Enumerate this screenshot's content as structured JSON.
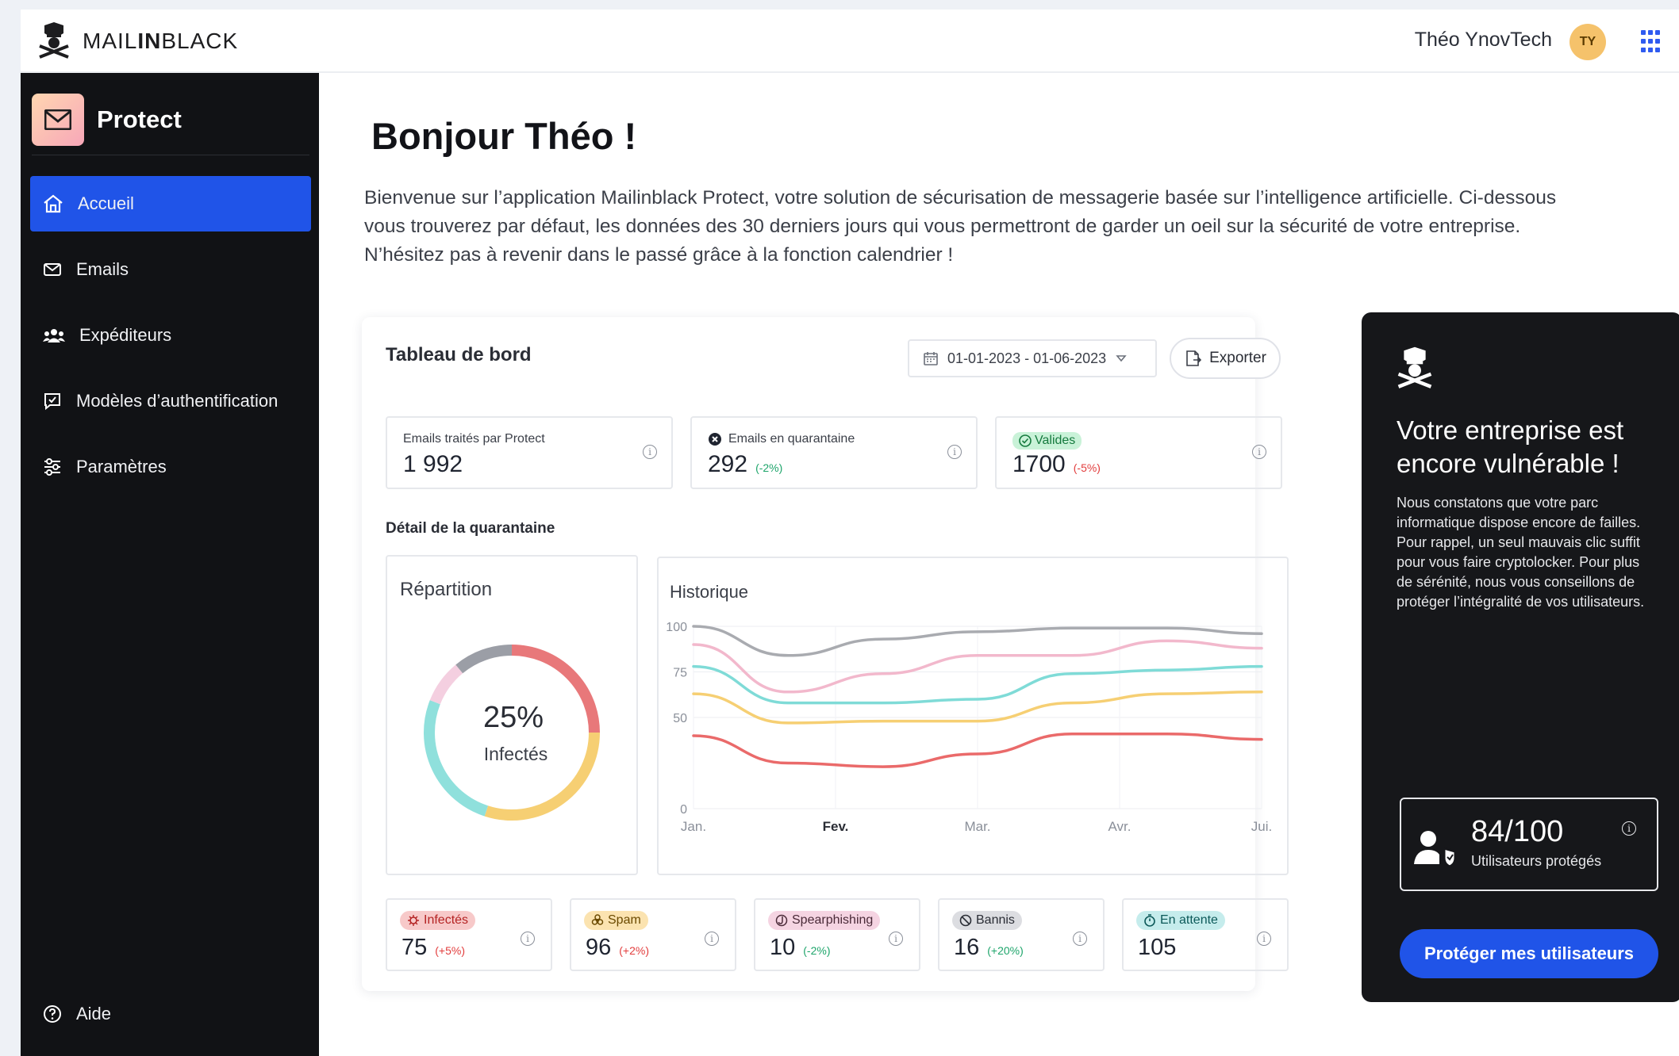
{
  "brand": {
    "name_part1": "MAIL",
    "name_part2": "IN",
    "name_part3": "BLACK"
  },
  "user": {
    "name": "Théo YnovTech",
    "initials": "TY"
  },
  "product": {
    "name": "Protect"
  },
  "sidebar": {
    "items": [
      {
        "label": "Accueil",
        "icon": "home-icon",
        "active": true
      },
      {
        "label": "Emails",
        "icon": "mail-icon",
        "active": false
      },
      {
        "label": "Expéditeurs",
        "icon": "users-icon",
        "active": false
      },
      {
        "label": "Modèles d’authentification",
        "icon": "chat-check-icon",
        "active": false
      },
      {
        "label": "Paramètres",
        "icon": "sliders-icon",
        "active": false
      }
    ],
    "help": "Aide"
  },
  "greeting": "Bonjour Théo !",
  "intro": "Bienvenue sur l’application Mailinblack Protect, votre solution de sécurisation de messagerie basée sur l’intelligence artificielle. Ci-dessous vous trouverez par défaut, les données des 30 derniers jours qui vous permettront de garder un oeil sur la sécurité de votre entreprise. N’hésitez pas à revenir dans le passé grâce à la fonction calendrier !",
  "dashboard": {
    "title": "Tableau de bord",
    "date_range": "01-01-2023  - 01-06-2023",
    "export": "Exporter",
    "kpis": [
      {
        "label": "Emails traités par Protect",
        "value": "1 992",
        "delta": ""
      },
      {
        "label": "Emails en quarantaine",
        "value": "292",
        "delta": "(-2%)"
      },
      {
        "label": "Valides",
        "value": "1700",
        "delta": "(-5%)"
      }
    ],
    "quarantine_title": "Détail de la quarantaine",
    "repartition": {
      "title": "Répartition",
      "percent": "25%",
      "label": "Infectés"
    },
    "history": {
      "title": "Historique"
    },
    "stats": [
      {
        "label": "Infectés",
        "value": "75",
        "delta": "(+5%)",
        "bg": "#f7c9c9",
        "fg": "#b42323"
      },
      {
        "label": "Spam",
        "value": "96",
        "delta": "(+2%)",
        "bg": "#fbe3b0",
        "fg": "#6b4a00"
      },
      {
        "label": "Spearphishing",
        "value": "10",
        "delta": "(-2%)",
        "bg": "#f5d4e2",
        "fg": "#4a2a38"
      },
      {
        "label": "Bannis",
        "value": "16",
        "delta": "(+20%)",
        "bg": "#dcdde1",
        "fg": "#2a2d35"
      },
      {
        "label": "En attente",
        "value": "105",
        "delta": "",
        "bg": "#c5ecec",
        "fg": "#0d5a5a"
      }
    ]
  },
  "promo": {
    "title": "Votre entreprise est encore vulnérable !",
    "text": "Nous constatons que votre parc informatique dispose encore de failles. Pour rappel, un seul mauvais clic suffit pour vous faire cryptolocker. Pour plus de sérénité, nous vous conseillons de protéger l’intégralité de vos utilisateurs.",
    "score": "84/100",
    "score_label": "Utilisateurs protégés",
    "button": "Protéger mes utilisateurs"
  },
  "chart_data": [
    {
      "type": "pie",
      "title": "Répartition",
      "center_label": "25% Infectés",
      "slices": [
        {
          "name": "Infectés",
          "value": 25,
          "color": "#e8787a"
        },
        {
          "name": "Spam",
          "value": 30,
          "color": "#f6cf73"
        },
        {
          "name": "En attente",
          "value": 26,
          "color": "#8fe0dc"
        },
        {
          "name": "Spearphishing",
          "value": 8,
          "color": "#f4cfe0"
        },
        {
          "name": "Bannis",
          "value": 11,
          "color": "#9b9ea6"
        }
      ]
    },
    {
      "type": "line",
      "title": "Historique",
      "x": [
        "Jan.",
        "Fev.",
        "Mar.",
        "Avr.",
        "Jui."
      ],
      "y_ticks": [
        0,
        50,
        75,
        100
      ],
      "ylim": [
        0,
        100
      ],
      "series": [
        {
          "color": "#a9abb0",
          "values": [
            100,
            84,
            93,
            97,
            99,
            99,
            96
          ]
        },
        {
          "color": "#f2b8cc",
          "values": [
            90,
            64,
            74,
            84,
            84,
            92,
            88
          ]
        },
        {
          "color": "#7fdbd7",
          "values": [
            78,
            58,
            58,
            60,
            74,
            76,
            78
          ]
        },
        {
          "color": "#f6cf73",
          "values": [
            63,
            47,
            48,
            48,
            58,
            63,
            64
          ]
        },
        {
          "color": "#ea6a6a",
          "values": [
            40,
            25,
            23,
            30,
            41,
            41,
            38
          ]
        }
      ]
    }
  ]
}
